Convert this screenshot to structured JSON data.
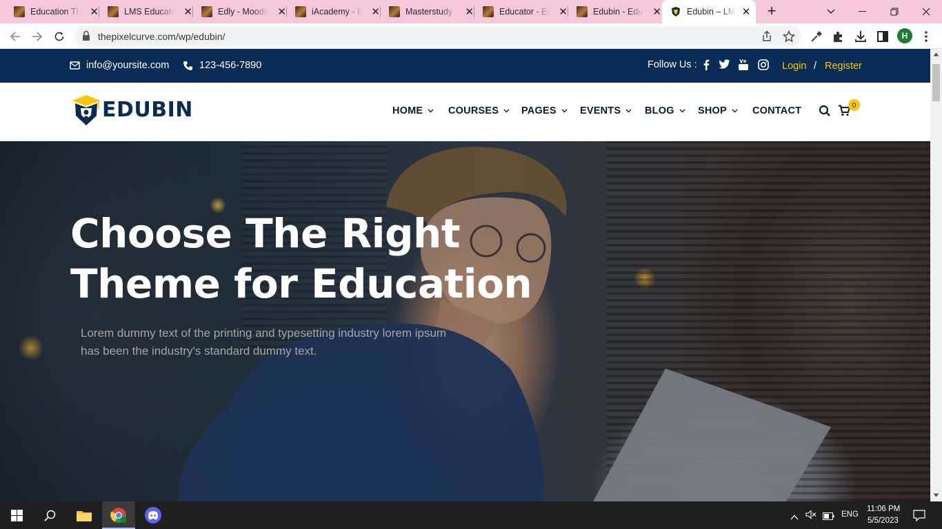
{
  "browser": {
    "tabs": [
      {
        "title": "Education Theme",
        "active": false
      },
      {
        "title": "LMS Education",
        "active": false
      },
      {
        "title": "Edly - Moodle",
        "active": false
      },
      {
        "title": "iAcademy - Education",
        "active": false
      },
      {
        "title": "Masterstudy",
        "active": false
      },
      {
        "title": "Educator - Education",
        "active": false
      },
      {
        "title": "Edubin - Education",
        "active": false
      },
      {
        "title": "Edubin – LMS",
        "active": true
      }
    ],
    "url": "thepixelcurve.com/wp/edubin/",
    "profile_initial": "H"
  },
  "topbar": {
    "email": "info@yoursite.com",
    "phone": "123-456-7890",
    "follow_label": "Follow Us :",
    "login": "Login",
    "separator": "/",
    "register": "Register"
  },
  "header": {
    "logo_text": "EDUBIN",
    "nav": [
      "HOME",
      "COURSES",
      "PAGES",
      "EVENTS",
      "BLOG",
      "SHOP",
      "CONTACT"
    ],
    "cart_count": "0"
  },
  "hero": {
    "title_line1": "Choose The Right",
    "title_line2": "Theme for Education",
    "subtitle_line1": "Lorem dummy text of the printing and typesetting industry lorem ipsum",
    "subtitle_line2": "has been the industry's standard dummy text."
  },
  "taskbar": {
    "language": "ENG",
    "time": "11:06 PM",
    "date": "5/5/2023"
  },
  "colors": {
    "topbar_bg": "#082c56",
    "accent_yellow": "#ffc600",
    "tabbar_bg": "#f5c8dc"
  }
}
